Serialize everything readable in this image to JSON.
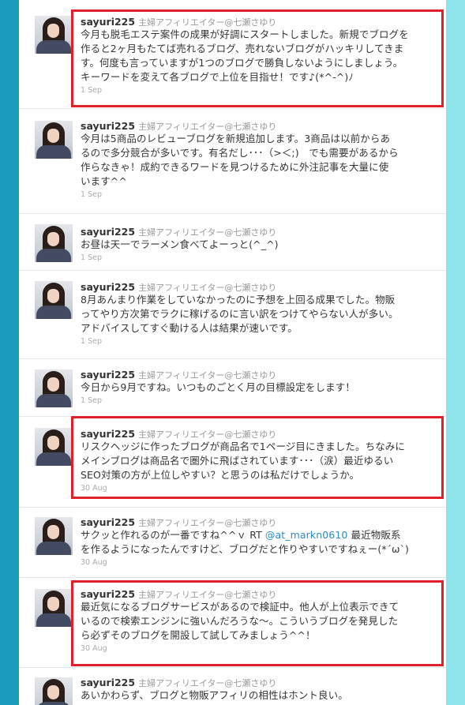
{
  "colors": {
    "highlight": "#e2202b",
    "mention": "#2a8bc6",
    "sidebar_dark": "#1a9bb9",
    "sidebar_light": "#8fe3ea"
  },
  "icons": {
    "avatar": "profile-photo"
  },
  "tweets": [
    {
      "username": "sayuri225",
      "fullname": "主婦アフィリエイター@七瀬さゆり",
      "lines": [
        "今月も脱毛エステ案件の成果が好調にスタートしました。新規でブログを",
        "作ると2ヶ月もたてば売れるブログ、売れないブログがハッキリしてきま",
        "す。何度も言っていますが1つのブログで勝負しないようにしましょう。",
        "キーワードを変えて各ブログで上位を目指せ！です♪(*^-^)ﾉ"
      ],
      "time": "1 Sep",
      "highlighted": true
    },
    {
      "username": "sayuri225",
      "fullname": "主婦アフィリエイター@七瀬さゆり",
      "lines": [
        "今月は5商品のレビューブログを新規追加します。3商品は以前からあ",
        "るので多分競合が多いです。有名だし･･･（>＜;)　でも需要があるから",
        "作らなきゃ！成約できるワードを見つけるために外注記事を大量に使",
        "います^^"
      ],
      "time": "1 Sep",
      "highlighted": false
    },
    {
      "username": "sayuri225",
      "fullname": "主婦アフィリエイター@七瀬さゆり",
      "lines": [
        "お昼は天一でラーメン食べてよーっと(^_^)"
      ],
      "time": "1 Sep",
      "highlighted": false
    },
    {
      "username": "sayuri225",
      "fullname": "主婦アフィリエイター@七瀬さゆり",
      "lines": [
        "8月あんまり作業をしていなかったのに予想を上回る成果でした。物販",
        "ってやり方次第でラクに稼げるのに言い訳をつけてやらない人が多い。",
        "アドバイスしてすぐ動ける人は結果が速いです。"
      ],
      "time": "1 Sep",
      "highlighted": false
    },
    {
      "username": "sayuri225",
      "fullname": "主婦アフィリエイター@七瀬さゆり",
      "lines": [
        "今日から9月ですね。いつものごとく月の目標設定をします！"
      ],
      "time": "1 Sep",
      "highlighted": false
    },
    {
      "username": "sayuri225",
      "fullname": "主婦アフィリエイター@七瀬さゆり",
      "lines": [
        "リスクヘッジに作ったブログが商品名で1ページ目にきました。ちなみに",
        "メインブログは商品名で圏外に飛ばされています･･･（涙）最近ゆるい",
        "SEO対策の方が上位しやすい？と思うのは私だけでしょうか。"
      ],
      "time": "30 Aug",
      "highlighted": true
    },
    {
      "username": "sayuri225",
      "fullname": "主婦アフィリエイター@七瀬さゆり",
      "line1_pre": "サクッと作れるのが一番ですね^^ｖ RT ",
      "mention": "@at_markn0610",
      "line1_post": " 最近物販系",
      "lines": [
        "を作るようになったんですけど、ブログだと作りやすいですねぇー(*´ω`)"
      ],
      "time": "30 Aug",
      "highlighted": false
    },
    {
      "username": "sayuri225",
      "fullname": "主婦アフィリエイター@七瀬さゆり",
      "lines": [
        "最近気になるブログサービスがあるので検証中。他人が上位表示できて",
        "いるので検索エンジンに強いんだろうな～。こういうブログを発見した",
        "ら必ずそのブログを開設して試してみましょう^^！"
      ],
      "time": "30 Aug",
      "highlighted": true
    },
    {
      "username": "sayuri225",
      "fullname": "主婦アフィリエイター@七瀬さゆり",
      "lines": [
        "あいかわらず、ブログと物販アフィリの相性はホント良い。"
      ],
      "time": "",
      "highlighted": false
    }
  ]
}
